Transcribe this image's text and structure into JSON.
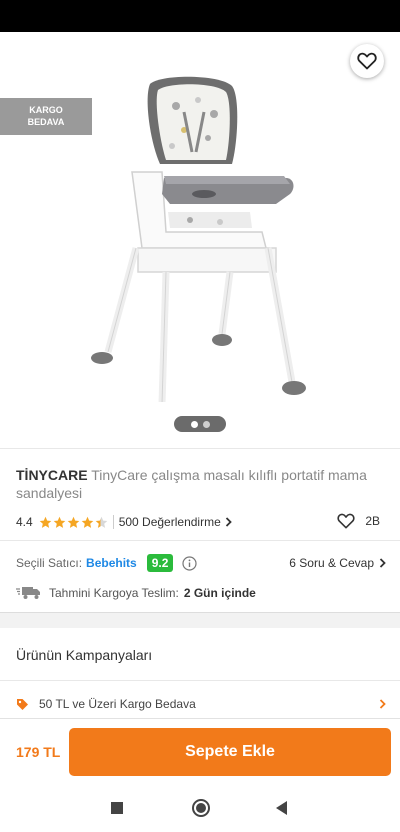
{
  "hero": {
    "badge_line1": "KARGO",
    "badge_line2": "BEDAVA",
    "image_count": 2,
    "current_image": 1
  },
  "product": {
    "brand": "TİNYCARE",
    "name": "TinyCare çalışma masalı kılıflı portatif mama sandalyesi",
    "rating": "4.4",
    "rating_value": 4.4,
    "reviews": "500 Değerlendirme",
    "likes": "2B"
  },
  "seller": {
    "label": "Seçili Satıcı:",
    "name": "Bebehits",
    "score": "9.2",
    "qa": "6 Soru & Cevap"
  },
  "delivery": {
    "label": "Tahmini Kargoya Teslim:",
    "days": "2 Gün içinde"
  },
  "campaigns": {
    "title": "Ürünün Kampanyaları",
    "items": [
      {
        "label": "50 TL ve Üzeri Kargo Bedava"
      }
    ]
  },
  "bottom": {
    "price": "179 TL",
    "cart_label": "Sepete Ekle"
  },
  "colors": {
    "accent": "#f27a1a",
    "seller_link": "#1e88e5",
    "score_badge": "#2bbb3c",
    "star": "#f5a623",
    "badge_gray": "#9a9a9a"
  },
  "icons": {
    "back": "arrow-left-icon",
    "share": "share-icon",
    "favorite": "heart-outline-icon",
    "info": "info-icon",
    "truck": "truck-icon",
    "tag": "tag-icon"
  }
}
